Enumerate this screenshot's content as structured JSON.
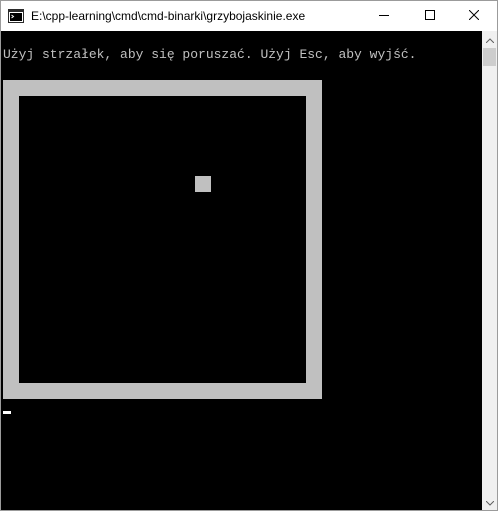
{
  "window": {
    "title": "E:\\cpp-learning\\cmd\\cmd-binarki\\grzybojaskinie.exe",
    "icon": "console-app-icon",
    "controls": [
      "minimize-icon",
      "maximize-icon",
      "close-icon"
    ]
  },
  "console": {
    "instruction": "Użyj strzałek, aby się poruszać. Użyj Esc, aby wyjść."
  },
  "colors": {
    "console_background": "#000000",
    "console_text": "#c0c0c0",
    "wall": "#c0c0c0",
    "player": "#c0c0c0",
    "titlebar": "#ffffff"
  }
}
